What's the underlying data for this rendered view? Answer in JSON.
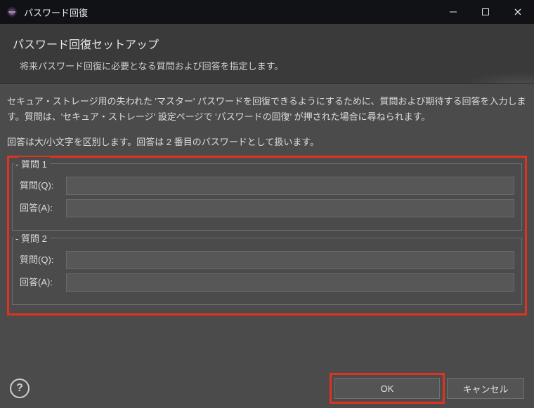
{
  "window": {
    "title": "パスワード回復"
  },
  "banner": {
    "heading": "パスワード回復セットアップ",
    "subtext": "将来パスワード回復に必要となる質問および回答を指定します。"
  },
  "desc": {
    "p1": "セキュア・ストレージ用の失われた 'マスター' パスワードを回復できるようにするために、質問および期待する回答を入力します。質問は、'セキュア・ストレージ' 設定ページで 'パスワードの回復' が押された場合に尋ねられます。",
    "p2": "回答は大/小文字を区別します。回答は 2 番目のパスワードとして扱います。"
  },
  "groups": [
    {
      "legend": "質問 1",
      "question_label": "質問(Q):",
      "answer_label": "回答(A):",
      "question_value": "",
      "answer_value": ""
    },
    {
      "legend": "質問 2",
      "question_label": "質問(Q):",
      "answer_label": "回答(A):",
      "question_value": "",
      "answer_value": ""
    }
  ],
  "buttons": {
    "ok": "OK",
    "cancel": "キャンセル"
  }
}
